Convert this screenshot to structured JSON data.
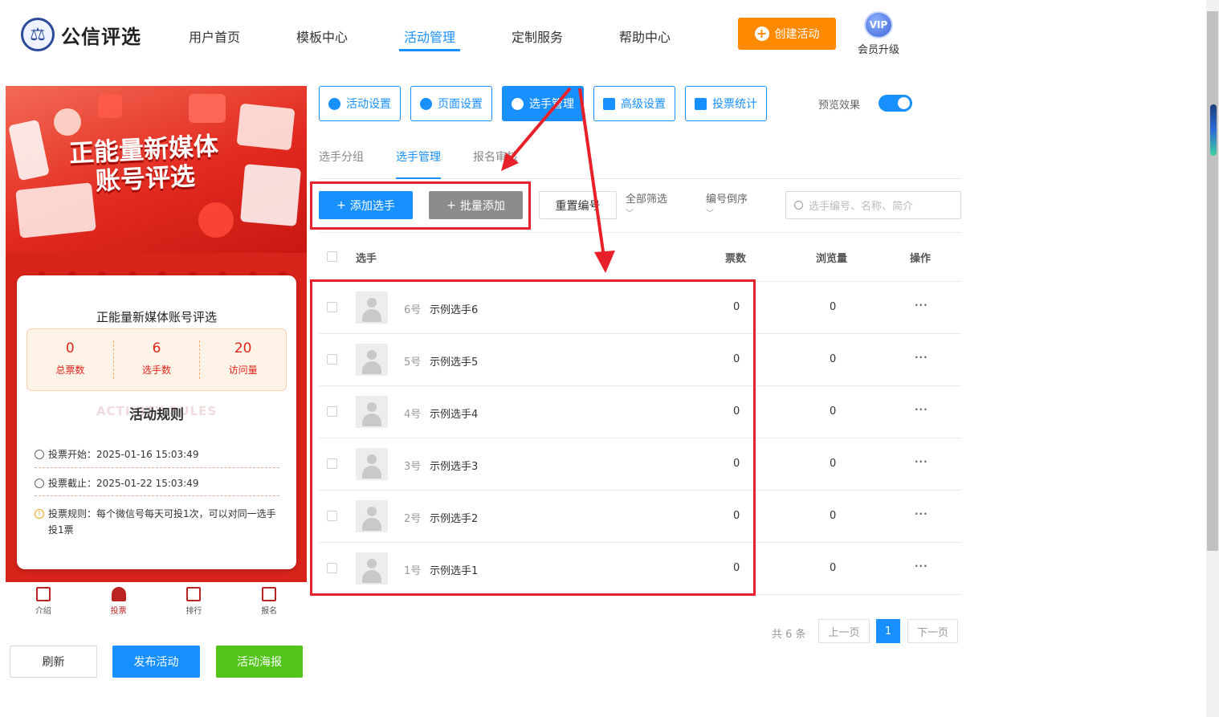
{
  "header": {
    "brand": "公信评选",
    "nav": [
      "用户首页",
      "模板中心",
      "活动管理",
      "定制服务",
      "帮助中心"
    ],
    "active_nav": "活动管理",
    "create_label": "创建活动",
    "vip_badge": "VIP",
    "vip_label": "会员升级"
  },
  "preview": {
    "poster_title_1": "正能量新媒体",
    "poster_title_2": "账号评选",
    "card_title": "正能量新媒体账号评选",
    "stats": [
      {
        "value": "0",
        "label": "总票数"
      },
      {
        "value": "6",
        "label": "选手数"
      },
      {
        "value": "20",
        "label": "访问量"
      }
    ],
    "rules_bg": "ACTIVITY RULES",
    "rules_title": "活动规则",
    "vote_start": "投票开始：2025-01-16 15:03:49",
    "vote_end": "投票截止：2025-01-22 15:03:49",
    "rule_text": "投票规则：每个微信号每天可投1次，可以对同一选手投1票",
    "tabs": [
      "介绍",
      "投票",
      "排行",
      "报名"
    ],
    "active_tab": "投票"
  },
  "actions": {
    "refresh": "刷新",
    "publish": "发布活动",
    "poster": "活动海报"
  },
  "settings_tabs": [
    "活动设置",
    "页面设置",
    "选手管理",
    "高级设置",
    "投票统计"
  ],
  "preview_toggle_label": "预览效果",
  "sub_tabs": [
    "选手分组",
    "选手管理",
    "报名审核"
  ],
  "toolbar": {
    "add": "添加选手",
    "batch": "批量添加",
    "reset": "重置编号",
    "filter": "全部筛选",
    "sort": "编号倒序",
    "search_placeholder": "选手编号、名称、简介"
  },
  "table": {
    "headers": [
      "选手",
      "票数",
      "浏览量",
      "操作"
    ],
    "rows": [
      {
        "num": "6号",
        "name": "示例选手6",
        "votes": "0",
        "views": "0"
      },
      {
        "num": "5号",
        "name": "示例选手5",
        "votes": "0",
        "views": "0"
      },
      {
        "num": "4号",
        "name": "示例选手4",
        "votes": "0",
        "views": "0"
      },
      {
        "num": "3号",
        "name": "示例选手3",
        "votes": "0",
        "views": "0"
      },
      {
        "num": "2号",
        "name": "示例选手2",
        "votes": "0",
        "views": "0"
      },
      {
        "num": "1号",
        "name": "示例选手1",
        "votes": "0",
        "views": "0"
      }
    ],
    "more": "···"
  },
  "pagination": {
    "total": "共 6 条",
    "prev": "上一页",
    "current": "1",
    "next": "下一页"
  },
  "colors": {
    "accent": "#1890ff",
    "create": "#ff8a00",
    "publish": "#1890ff",
    "poster": "#52c41a",
    "highlight": "#e8202a"
  }
}
